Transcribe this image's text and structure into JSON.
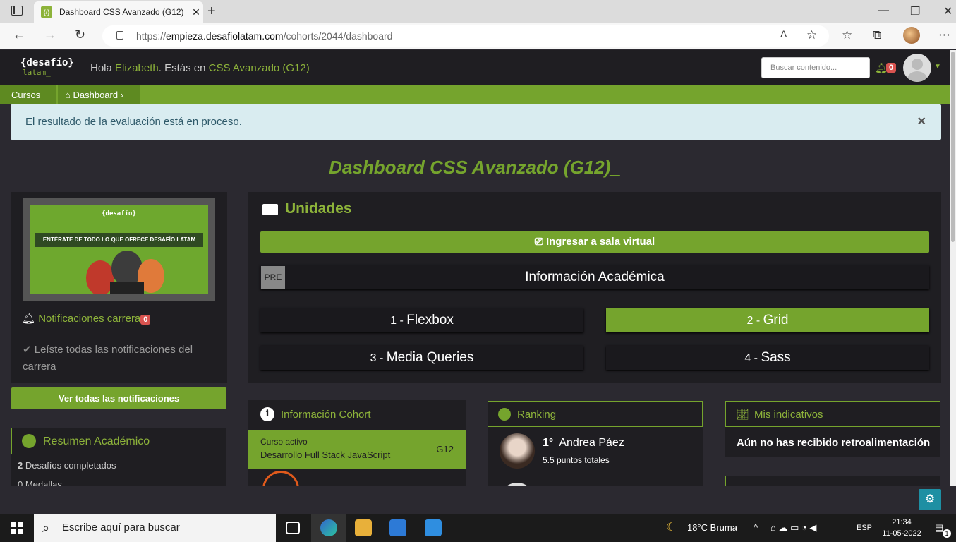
{
  "browser": {
    "tab_title": "Dashboard CSS Avanzado (G12)",
    "url_prefix": "https://",
    "url_host": "empieza.desafiolatam.com",
    "url_path": "/cohorts/2044/dashboard"
  },
  "header": {
    "logo_main": "{desafío}",
    "logo_sub": "latam_",
    "greeting_hola": "Hola ",
    "user_name": "Elizabeth",
    "greeting_mid": ". Estás en ",
    "course_name": "CSS Avanzado (G12)",
    "search_placeholder": "Buscar contenido...",
    "notif_count": "0"
  },
  "breadcrumb": {
    "cursos": "Cursos",
    "dashboard": "Dashboard"
  },
  "alert": {
    "text": "El resultado de la evaluación está en proceso."
  },
  "page_title": "Dashboard CSS Avanzado (G12)_",
  "left": {
    "promo_logo": "{desafío}",
    "promo_text": "ENTÉRATE DE TODO LO QUE OFRECE DESAFÍO LATAM",
    "notif_title": "Notificaciones carrera",
    "notif_count": "0",
    "notif_text": "Leíste todas las notificaciones del carrera",
    "see_all": "Ver todas las notificaciones",
    "resumen_title": "Resumen Académico",
    "desafios_count": "2",
    "desafios_label": " Desafíos completados",
    "medallas": "0 Medallas"
  },
  "units": {
    "title": "Unidades",
    "sala": "Ingresar a sala virtual",
    "pre": "PRE",
    "info_academica": "Información Académica",
    "items": [
      {
        "num": "1 - ",
        "label": "Flexbox"
      },
      {
        "num": "2 - ",
        "label": "Grid"
      },
      {
        "num": "3 - ",
        "label": "Media Queries"
      },
      {
        "num": "4 - ",
        "label": "Sass"
      }
    ]
  },
  "cohort": {
    "title": "Información Cohort",
    "curso_activo": "Curso activo",
    "program": "Desarrollo Full Stack JavaScript",
    "group": "G12"
  },
  "ranking": {
    "title": "Ranking",
    "position": "1°",
    "name": "Andrea Páez",
    "points": "5.5 puntos totales"
  },
  "indicators": {
    "title": "Mis indicativos",
    "text": "Aún no has recibido retroalimentación"
  },
  "taskbar": {
    "search": "Escribe aquí para buscar",
    "weather": "18°C  Bruma",
    "lang": "ESP",
    "time": "21:34",
    "date": "11-05-2022",
    "notif": "1"
  },
  "colors": {
    "accent": "#75a42d",
    "header": "#1f1e22",
    "alert_bg": "#d9ecf0"
  }
}
